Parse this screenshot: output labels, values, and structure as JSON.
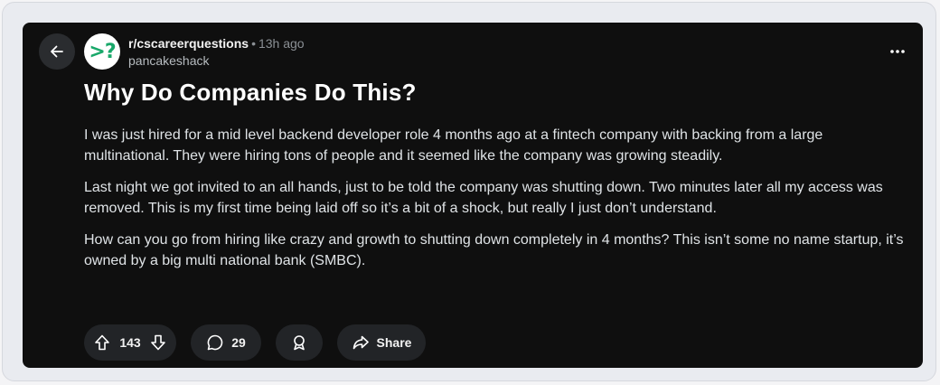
{
  "post": {
    "subreddit": "r/cscareerquestions",
    "separator": "•",
    "time": "13h ago",
    "author": "pancakeshack",
    "avatar_text": ">?",
    "title": "Why Do Companies Do This?",
    "paragraphs": [
      "I was just hired for a mid level backend developer role 4 months ago at a fintech company with backing from a large multinational. They were hiring tons of people and it seemed like the company was growing steadily.",
      "Last night we got invited to an all hands, just to be told the company was shutting down. Two minutes later all my access was removed. This is my first time being laid off so it’s a bit of a shock, but really I just don’t understand.",
      "How can you go from hiring like crazy and growth to shutting down completely in 4 months? This isn’t some no name startup, it’s owned by a big multi national bank (SMBC)."
    ]
  },
  "actions": {
    "vote_count": "143",
    "comment_count": "29",
    "share_label": "Share"
  },
  "icons": {
    "back": "arrow-left-icon",
    "more": "more-horizontal-icon",
    "upvote": "arrow-up-icon",
    "downvote": "arrow-down-icon",
    "comment": "comment-bubble-icon",
    "award": "award-icon",
    "share": "share-arrow-icon"
  },
  "colors": {
    "card_background": "#0f0f0f",
    "pill_background": "#222427",
    "avatar_background": "#ffffff",
    "avatar_glyph": "#19a86a",
    "text_primary": "#ffffff",
    "text_secondary": "#8b9095"
  }
}
